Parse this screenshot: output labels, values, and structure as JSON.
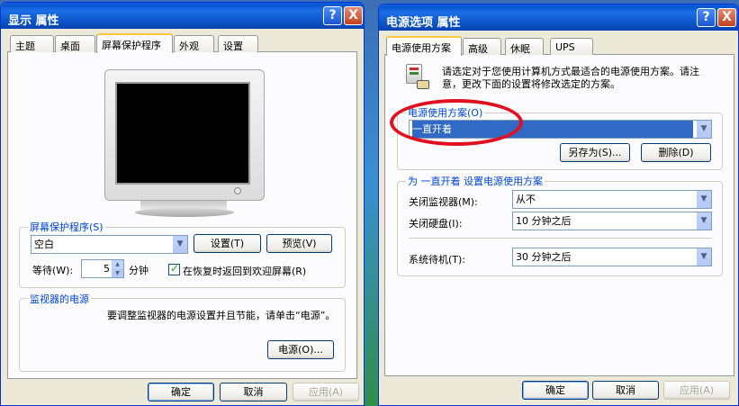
{
  "left_window": {
    "title": "显示 属性",
    "help_button": "?",
    "close_button": "X",
    "tabs": [
      "主题",
      "桌面",
      "屏幕保护程序",
      "外观",
      "设置"
    ],
    "screensaver": {
      "group_label": "屏幕保护程序(S)",
      "selected": "空白",
      "settings_button": "设置(T)",
      "preview_button": "预览(V)",
      "wait_label": "等待(W):",
      "wait_value": "5",
      "wait_unit": "分钟",
      "resume_checkbox_label": "在恢复时返回到欢迎屏幕(R)",
      "resume_checked": true
    },
    "monitor_power": {
      "group_label": "监视器的电源",
      "description": "要调整监视器的电源设置并且节能，请单击“电源”。",
      "power_button": "电源(O)..."
    },
    "footer": {
      "ok": "确定",
      "cancel": "取消",
      "apply": "应用(A)"
    }
  },
  "right_window": {
    "title": "电源选项 属性",
    "help_button": "?",
    "close_button": "X",
    "tabs": [
      "电源使用方案",
      "高级",
      "休眠",
      "UPS"
    ],
    "intro_text": "请选定对于您使用计算机方式最适合的电源使用方案。请注意，更改下面的设置将修改选定的方案。",
    "scheme_group_label": "电源使用方案(O)",
    "scheme_selected": "一直开着",
    "save_as_button": "另存为(S)...",
    "delete_button": "删除(D)",
    "settings_group_label": "为 一直开着 设置电源使用方案",
    "settings": [
      {
        "label": "关闭监视器(M):",
        "value": "从不"
      },
      {
        "label": "关闭硬盘(I):",
        "value": "10 分钟之后"
      },
      {
        "label": "系统待机(T):",
        "value": "30 分钟之后"
      }
    ],
    "footer": {
      "ok": "确定",
      "cancel": "取消",
      "apply": "应用(A)"
    }
  },
  "annotation_color": "#e01020"
}
